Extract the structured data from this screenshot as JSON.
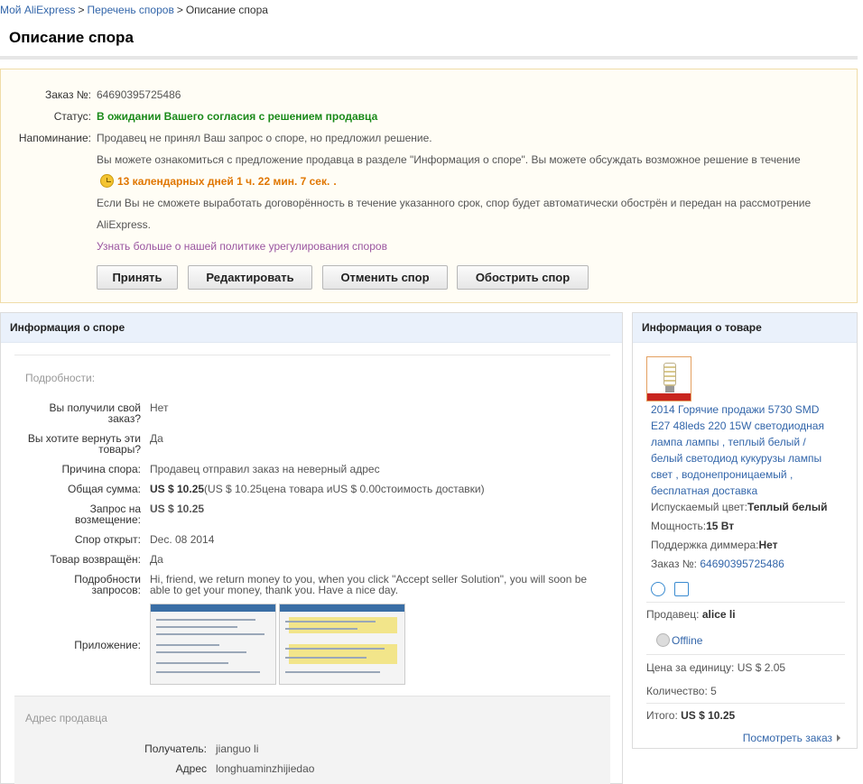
{
  "breadcrumb": {
    "home": "Мой AliExpress",
    "separator": ">",
    "disputes": "Перечень споров",
    "current": "Описание спора"
  },
  "page_title": "Описание спора",
  "status_box": {
    "order_label": "Заказ №:",
    "order_value": "64690395725486",
    "status_label": "Статус:",
    "status_value": "В ожидании Вашего согласия с решением продавца",
    "reminder_label": "Напоминание:",
    "reminder_line1": "Продавец не принял Ваш запрос о споре, но предложил решение.",
    "reminder_line2": "Вы можете ознакомиться с предложение продавца в разделе \"Информация о споре\". Вы можете обсуждать возможное решение в течение",
    "timer": "13 календарных дней 1 ч. 22 мин. 7 сек.",
    "timer_suffix": ".",
    "reminder_line3": "Если Вы не сможете выработать договорённость в течение указанного срок, спор будет автоматически обострён и передан на рассмотрение",
    "reminder_line4": "AliExpress.",
    "policy_link": "Узнать больше о нашей политике урегулирования споров",
    "buttons": {
      "accept": "Принять",
      "edit": "Редактировать",
      "cancel": "Отменить спор",
      "escalate": "Обострить спор"
    }
  },
  "dispute_info": {
    "header": "Информация о споре",
    "details_title": "Подробности:",
    "received_label_1": "Вы получили свой",
    "received_label_2": "заказ?",
    "received_value": "Нет",
    "return_label_1": "Вы хотите вернуть эти",
    "return_label_2": "товары?",
    "return_value": "Да",
    "reason_label": "Причина спора:",
    "reason_value": "Продавец отправил заказ на неверный адрес",
    "total_label": "Общая сумма:",
    "total_value": "US $ 10.25",
    "total_detail": "(US $ 10.25цена товара иUS $ 0.00стоимость доставки)",
    "refund_label_1": "Запрос на",
    "refund_label_2": "возмещение:",
    "refund_value": "US $ 10.25",
    "opened_label": "Спор открыт:",
    "opened_value": "Dec. 08 2014",
    "returned_label": "Товар возвращён:",
    "returned_value": "Да",
    "request_label_1": "Подробности",
    "request_label_2": "запросов:",
    "request_value_1": "Hi, friend, we return money to you, when you click \"Accept seller Solution\", you will soon be",
    "request_value_2": "able to get your money, thank you. Have a nice day.",
    "attachment_label": "Приложение:",
    "seller_address_title": "Адрес продавца",
    "recipient_label": "Получатель:",
    "recipient_value": "jianguo li",
    "address_label": "Адрес",
    "address_value": "longhuaminzhijiedao"
  },
  "product_info": {
    "header": "Информация о товаре",
    "title": "2014 Горячие продажи 5730 SMD E27 48leds 220 15W светодиодная лампа лампы , теплый белый / белый светодиод кукурузы лампы свет , водонепроницаемый , бесплатная доставка",
    "color_label": "Испускаемый цвет:",
    "color_value": "Теплый белый",
    "power_label": "Мощность:",
    "power_value": "15 Вт",
    "dimmer_label": "Поддержка диммера:",
    "dimmer_value": "Нет",
    "order_label": "Заказ №:",
    "order_value": "64690395725486",
    "seller_label": "Продавец:",
    "seller_value": "alice li",
    "online_status": "Offline",
    "unit_price_label": "Цена за единицу:",
    "unit_price_value": "US $ 2.05",
    "quantity_label": "Количество:",
    "quantity_value": "5",
    "total_label": "Итого:",
    "total_value": "US $ 10.25",
    "view_order": "Посмотреть заказ"
  },
  "colors": {
    "link": "#3366aa",
    "status_green": "#1a8a1a",
    "timer_orange": "#e07600",
    "panel_header_bg": "#eaf1fb",
    "status_box_border": "#f0dca8"
  },
  "icons": [
    "clock-icon",
    "alarm-icon",
    "refresh-icon",
    "offline-status-icon",
    "chevron-right-icon"
  ]
}
